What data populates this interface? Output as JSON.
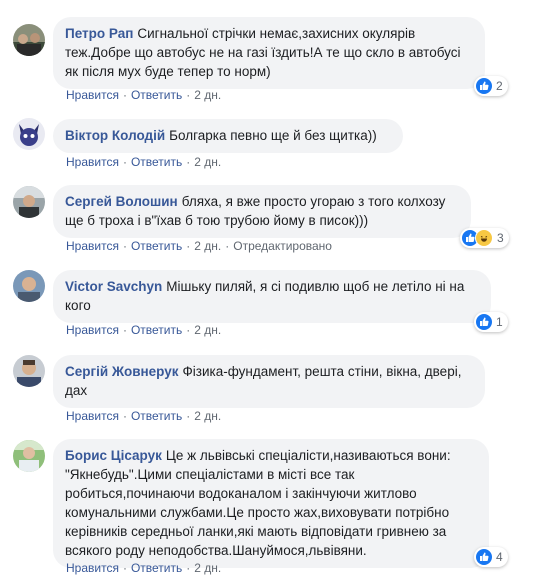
{
  "actions": {
    "like": "Нравится",
    "reply": "Ответить",
    "sep": "·",
    "edited": "Отредактировано"
  },
  "comments": [
    {
      "author": "Петро Рап",
      "text": "Сигнальної стрічки немає,захисних окулярів теж.Добре що автобус не на газі їздить!А те що скло в автобусі як після мух буде тепер то норм)",
      "time": "2 дн.",
      "reactions": {
        "icons": [
          "like-icon"
        ],
        "count": "2"
      }
    },
    {
      "author": "Віктор Колодій",
      "text": "Болгарка певно ще й без щитка))",
      "time": "2 дн."
    },
    {
      "author": "Сергей Волошин",
      "text": "бляха, я вже просто угораю з того колхозу ще б троха і в\"їхав б тою трубою йому в писок)))",
      "time": "2 дн.",
      "edited": true,
      "reactions": {
        "icons": [
          "like-icon",
          "haha-icon"
        ],
        "count": "3"
      }
    },
    {
      "author": "Victor Savchyn",
      "text": "Мішьку пиляй, я сі подивлю щоб не летіло ні на кого",
      "time": "2 дн.",
      "reactions": {
        "icons": [
          "like-icon"
        ],
        "count": "1"
      }
    },
    {
      "author": "Сергій Жовнерук",
      "text": "Фізика-фундамент, решта стіни, вікна, двері, дах",
      "time": "2 дн."
    },
    {
      "author": "Борис Цісарук",
      "text": "Це ж львівські спеціалісти,називаються вони: \"Якнебудь\".Цими спеціалістами в місті все так робиться,починаючи водоканалом і закінчуючи житлово комунальними службами.Це просто жах,виховувати потрібно керівників середньої ланки,які мають відповідати гривнею за всякого роду неподобства.Шануймося,львівяни.",
      "time": "2 дн.",
      "reactions": {
        "icons": [
          "like-icon"
        ],
        "count": "4"
      }
    }
  ],
  "colors": {
    "link": "#385898",
    "bubble": "#f2f3f5",
    "meta": "#606770",
    "like": "#1877f2"
  }
}
